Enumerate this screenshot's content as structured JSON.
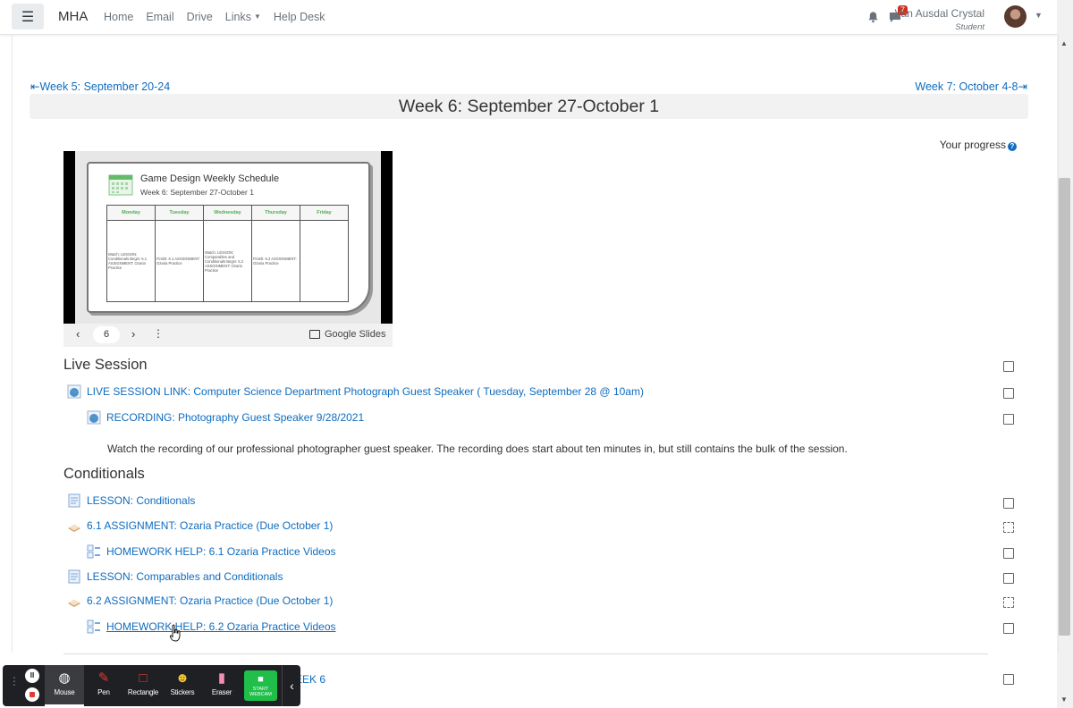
{
  "nav": {
    "brand": "MHA",
    "links": [
      "Home",
      "Email",
      "Drive",
      "Links",
      "Help Desk"
    ],
    "notifications_count": "7",
    "user_name": "Van Ausdal Crystal",
    "user_role": "Student"
  },
  "week": {
    "prev_link": "Week 5: September 20-24",
    "next_link": "Week 7: October 4-8",
    "title": "Week 6: September 27-October 1",
    "progress_label": "Your progress"
  },
  "slides": {
    "title": "Game Design Weekly Schedule",
    "subtitle": "Week 6:  September 27-October 1",
    "days": [
      "Monday",
      "Tuesday",
      "Wednesday",
      "Thursday",
      "Friday"
    ],
    "cells": [
      "Watch: LESSON: Conditionals  Begin: 6.1 ASSIGNMENT: Ozaria Practice",
      "Finish: 6.1 ASSIGNMENT: Ozaria Practice",
      "Watch: LESSON: Comparables and Conditionals  Begin: 6.2 ASSIGNMENT: Ozaria Practice",
      "Finish: 6.2 ASSIGNMENT: Ozaria Practice",
      ""
    ],
    "page": "6",
    "provider": "Google Slides"
  },
  "sections": {
    "live": {
      "title": "Live Session",
      "link1": "LIVE SESSION LINK: Computer Science Department Photograph Guest Speaker ( Tuesday, September 28 @ 10am)",
      "link2": "RECORDING: Photography Guest Speaker 9/28/2021",
      "description": "Watch the recording of our professional photographer guest speaker.  The recording does start about ten minutes in, but still contains the bulk of the session."
    },
    "conditionals": {
      "title": "Conditionals",
      "items": [
        "LESSON: Conditionals",
        "6.1 ASSIGNMENT: Ozaria Practice (Due October 1)",
        "HOMEWORK HELP: 6.1 Ozaria Practice Videos",
        "LESSON: Comparables and Conditionals",
        "6.2 ASSIGNMENT: Ozaria Practice (Due October 1)",
        "HOMEWORK HELP: 6.2 Ozaria Practice Videos"
      ]
    },
    "partial_link": "EEK 6"
  },
  "toolbar": {
    "tools": [
      "Mouse",
      "Pen",
      "Rectangle",
      "Stickers",
      "Eraser"
    ],
    "webcam_label": "START WEBCAM"
  }
}
